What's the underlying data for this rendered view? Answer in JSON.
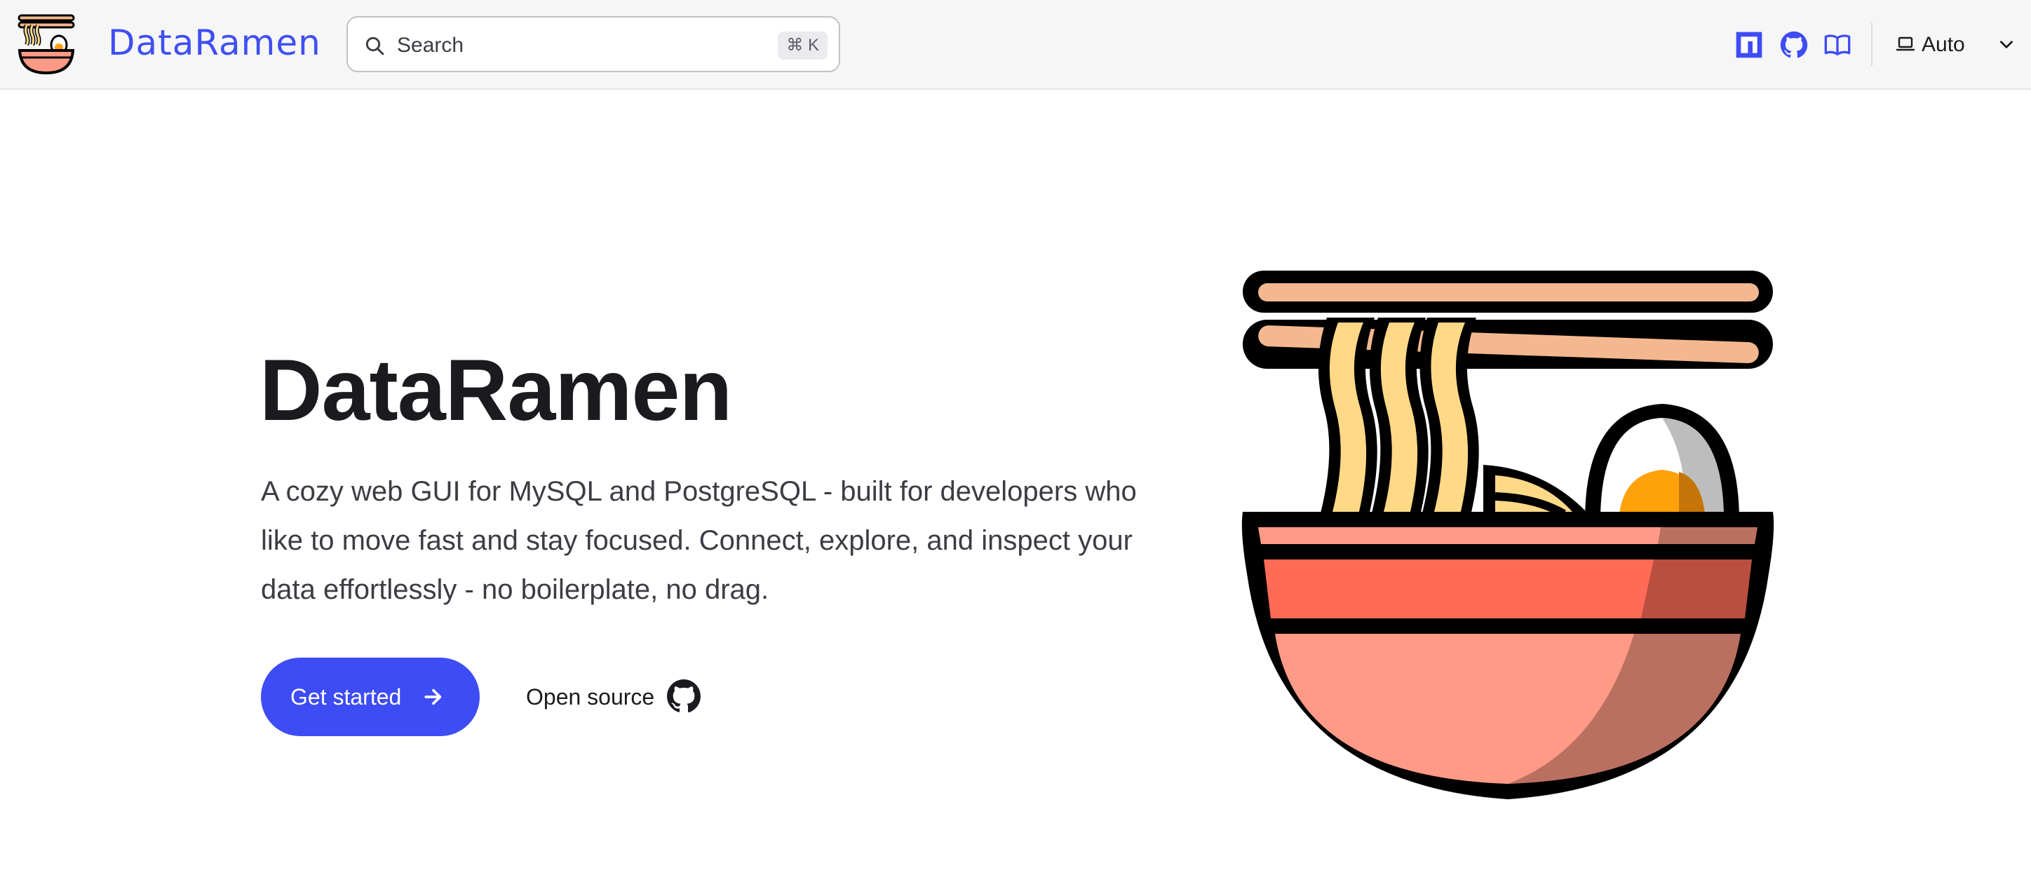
{
  "header": {
    "logo_icon": "ramen-bowl-logo",
    "site_title": "DataRamen",
    "search": {
      "placeholder": "Search",
      "shortcut": "⌘ K",
      "icon": "search-icon"
    },
    "social_links": [
      {
        "name": "npm",
        "icon": "npm-icon"
      },
      {
        "name": "github",
        "icon": "github-icon"
      },
      {
        "name": "docs",
        "icon": "book-icon"
      }
    ],
    "appearance": {
      "icon": "monitor-icon",
      "label": "Auto",
      "chevron": "chevron-down-icon"
    }
  },
  "hero": {
    "title": "DataRamen",
    "tagline": "A cozy web GUI for MySQL and PostgreSQL - built for developers who like to move fast and stay focused. Connect, explore, and inspect your data effortlessly - no boilerplate, no drag.",
    "primary_action": {
      "label": "Get started",
      "icon": "arrow-right-icon"
    },
    "secondary_action": {
      "label": "Open source",
      "icon": "github-icon"
    },
    "image": "ramen-bowl-illustration"
  },
  "colors": {
    "brand": "#3f4ff2",
    "button": "#3e4cf5",
    "nav_bg": "#f6f6f7",
    "bowl": "#ff9a86",
    "bowl_band": "#ff6b57",
    "noodles": "#ffd987",
    "chopsticks": "#f3b88f",
    "egg_yolk": "#ffa10a"
  }
}
